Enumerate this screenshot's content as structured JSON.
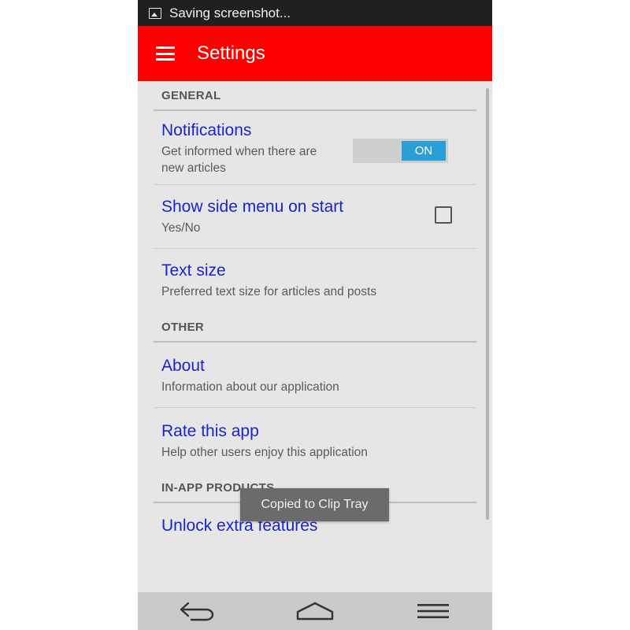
{
  "status_bar": {
    "text": "Saving screenshot...",
    "icon": "image-icon"
  },
  "app_bar": {
    "title": "Settings",
    "menu_icon": "hamburger-icon"
  },
  "sections": [
    {
      "header": "GENERAL"
    },
    {
      "header": "OTHER"
    },
    {
      "header": "IN-APP PRODUCTS"
    }
  ],
  "prefs": {
    "notifications": {
      "title": "Notifications",
      "summary": "Get informed when there are new articles",
      "toggle_label": "ON",
      "enabled": true
    },
    "side_menu": {
      "title": "Show side menu on start",
      "summary": "Yes/No",
      "checked": false
    },
    "text_size": {
      "title": "Text size",
      "summary": "Preferred text size for articles and posts"
    },
    "about": {
      "title": "About",
      "summary": "Information about our application"
    },
    "rate": {
      "title": "Rate this app",
      "summary": "Help other users enjoy this application"
    },
    "unlock": {
      "title": "Unlock extra features"
    }
  },
  "toast": {
    "text": "Copied to Clip Tray"
  },
  "nav_bar": {
    "buttons": [
      "back-icon",
      "home-icon",
      "menu-icon"
    ]
  },
  "colors": {
    "app_bar": "#ff0000",
    "title_text": "#1a24c8",
    "toggle_on": "#2a9fd6",
    "background": "#e6e6e6"
  }
}
